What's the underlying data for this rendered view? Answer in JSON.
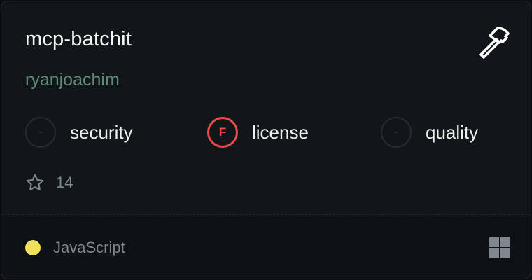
{
  "server": {
    "name": "mcp-batchit",
    "author": "ryanjoachim",
    "type_icon": "hammer-icon"
  },
  "scores": [
    {
      "grade": "-",
      "label": "security",
      "status": "none"
    },
    {
      "grade": "F",
      "label": "license",
      "status": "fail",
      "color": "#ef4a4a"
    },
    {
      "grade": "-",
      "label": "quality",
      "status": "none"
    }
  ],
  "stars": {
    "icon": "star-icon",
    "count": "14"
  },
  "footer": {
    "language": "JavaScript",
    "language_color": "#f1e05a",
    "platform_icon": "windows-icon"
  }
}
